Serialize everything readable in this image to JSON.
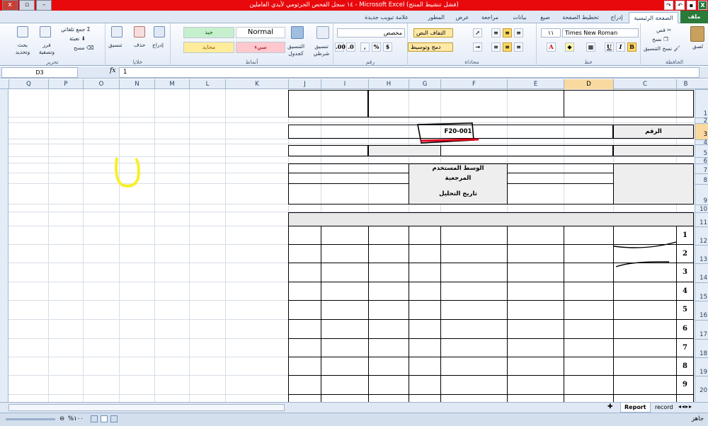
{
  "window": {
    "title": "١٤ سجل الفحص الجرثومي لأيدي العاملين - Microsoft Excel (فشل تنشيط المنتج)",
    "controls": [
      "x",
      "▫",
      "–"
    ]
  },
  "ribbon_tabs": [
    {
      "label": "ملف",
      "active": false,
      "file": true
    },
    {
      "label": "الصفحة الرئيسية",
      "active": true
    },
    {
      "label": "إدراج",
      "active": false
    },
    {
      "label": "تخطيط الصفحة",
      "active": false
    },
    {
      "label": "صيغ",
      "active": false
    },
    {
      "label": "بيانات",
      "active": false
    },
    {
      "label": "مراجعة",
      "active": false
    },
    {
      "label": "عرض",
      "active": false
    },
    {
      "label": "المطور",
      "active": false
    },
    {
      "label": "علامة تبويب جديدة",
      "active": false
    }
  ],
  "ribbon": {
    "clipboard": {
      "label": "الحافظة",
      "paste": "لصق",
      "cut": "قص",
      "copy": "نسخ",
      "format_painter": "نسخ التنسيق"
    },
    "font": {
      "label": "خط",
      "font_name": "Times New Roman",
      "font_size": "١١",
      "bold": "B",
      "italic": "I",
      "underline": "U"
    },
    "alignment": {
      "label": "محاذاة",
      "wrap": "التفاف النص",
      "merge": "دمج وتوسيط"
    },
    "number": {
      "label": "رقم",
      "format": "مخصص"
    },
    "styles": {
      "label": "أنماط",
      "conditional": "تنسيق شرطي",
      "as_table": "التنسيق كجدول",
      "normal": "Normal",
      "good": "جيد",
      "neutral": "محايد",
      "bad": "سيء"
    },
    "cells": {
      "label": "خلايا",
      "insert": "إدراج",
      "delete": "حذف",
      "format": "تنسيق"
    },
    "editing": {
      "label": "تحرير",
      "autosum": "جمع تلقائي",
      "fill": "تعبئة",
      "clear": "مسح",
      "sort": "فرز وتصفية",
      "find": "بحث وتحديد"
    }
  },
  "formula_bar": {
    "name_box": "D3",
    "fx": "fx",
    "value": "1"
  },
  "columns": [
    "B",
    "C",
    "D",
    "E",
    "F",
    "G",
    "H",
    "I",
    "J",
    "K",
    "L",
    "M",
    "N",
    "O",
    "P",
    "Q"
  ],
  "selected_column": "D",
  "rows": [
    "1",
    "2",
    "3",
    "4",
    "5",
    "6",
    "7",
    "8",
    "9",
    "10",
    "11",
    "12",
    "13",
    "14",
    "15",
    "16",
    "17",
    "18",
    "19",
    "20"
  ],
  "selected_row": "3",
  "sheet": {
    "label_number": "الرقم",
    "form_code": "F20-001",
    "medium_label": "الوسط المستخدم",
    "reference_label": "المرجعية",
    "analysis_date_label": "تاريخ التحليل",
    "numbered_rows": [
      "1",
      "2",
      "3",
      "4",
      "5",
      "6",
      "7",
      "8",
      "9"
    ]
  },
  "sheet_tabs": [
    {
      "label": "Report",
      "active": true
    },
    {
      "label": "record",
      "active": false
    }
  ],
  "status": {
    "ready": "جاهز",
    "zoom": "%١٠٠"
  }
}
